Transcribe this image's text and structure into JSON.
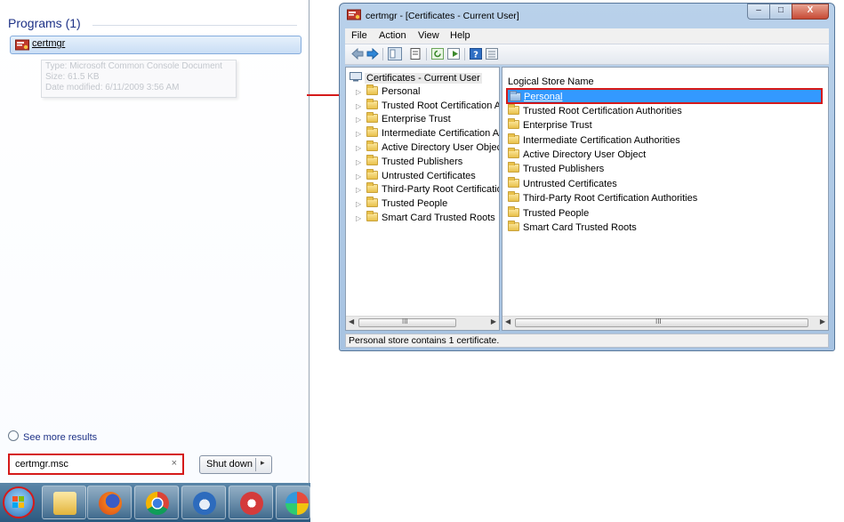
{
  "start_menu": {
    "programs_header": "Programs (1)",
    "program_item": "certmgr",
    "tooltip": {
      "type": "Type: Microsoft Common Console Document",
      "size": "Size: 61.5 KB",
      "date": "Date modified: 6/11/2009 3:56 AM"
    },
    "see_more": "See more results",
    "search_value": "certmgr.msc",
    "clear_glyph": "×",
    "shutdown_label": "Shut down",
    "shutdown_arrow": "▸"
  },
  "taskbar": {
    "items": [
      "windows-explorer",
      "firefox",
      "chrome",
      "thunderbird",
      "app",
      "picasa"
    ]
  },
  "window": {
    "title": "certmgr - [Certificates - Current User]",
    "controls": {
      "minimize": "–",
      "maximize": "□",
      "close": "X"
    },
    "menu": [
      "File",
      "Action",
      "View",
      "Help"
    ],
    "tree_root": "Certificates - Current User",
    "tree_items": [
      "Personal",
      "Trusted Root Certification Au",
      "Enterprise Trust",
      "Intermediate Certification Au",
      "Active Directory User Object",
      "Trusted Publishers",
      "Untrusted Certificates",
      "Third-Party Root Certificatior",
      "Trusted People",
      "Smart Card Trusted Roots"
    ],
    "list_header": "Logical Store Name",
    "list_items": [
      "Personal",
      "Trusted Root Certification Authorities",
      "Enterprise Trust",
      "Intermediate Certification Authorities",
      "Active Directory User Object",
      "Trusted Publishers",
      "Untrusted Certificates",
      "Third-Party Root Certification Authorities",
      "Trusted People",
      "Smart Card Trusted Roots"
    ],
    "scroll_grip": "III",
    "status": "Personal store contains 1 certificate."
  },
  "colors": {
    "highlight": "#d51a1a",
    "selection": "#3399ff",
    "link": "#1e3287"
  }
}
